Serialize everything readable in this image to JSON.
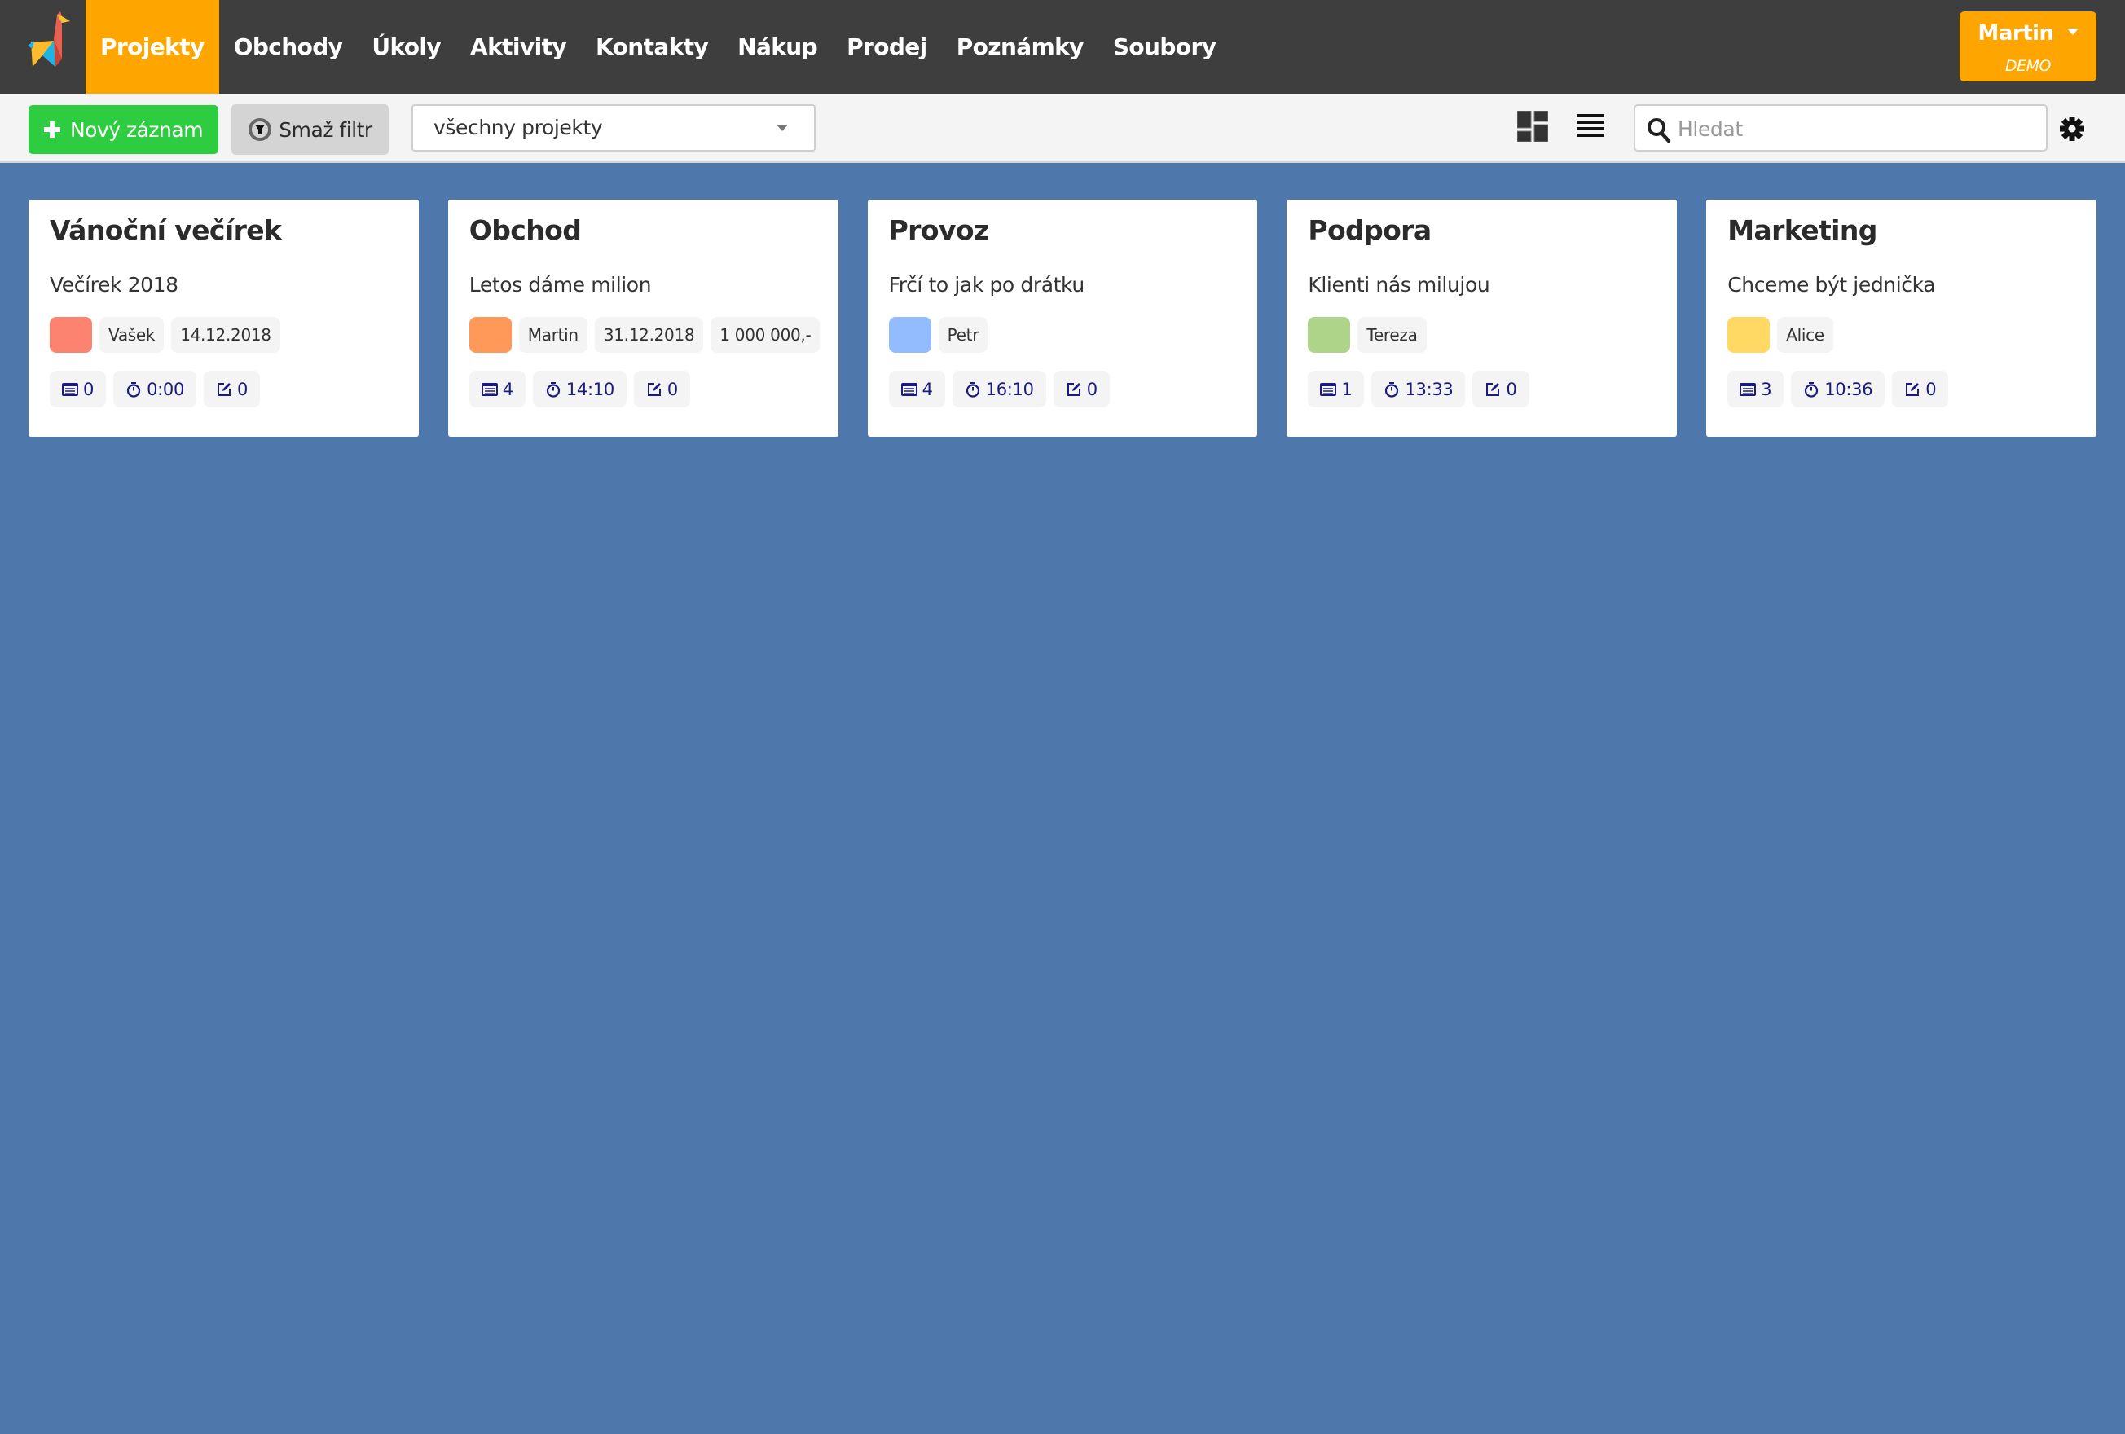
{
  "header": {
    "logo": "giraffe-logo",
    "nav": [
      {
        "label": "Projekty",
        "active": true
      },
      {
        "label": "Obchody",
        "active": false
      },
      {
        "label": "Úkoly",
        "active": false
      },
      {
        "label": "Aktivity",
        "active": false
      },
      {
        "label": "Kontakty",
        "active": false
      },
      {
        "label": "Nákup",
        "active": false
      },
      {
        "label": "Prodej",
        "active": false
      },
      {
        "label": "Poznámky",
        "active": false
      },
      {
        "label": "Soubory",
        "active": false
      }
    ],
    "user": {
      "name": "Martin",
      "role": "DEMO"
    }
  },
  "toolbar": {
    "new_label": "Nový záznam",
    "clear_filter_label": "Smaž filtr",
    "project_filter": {
      "selected": "všechny projekty"
    },
    "search": {
      "placeholder": "Hledat",
      "value": ""
    }
  },
  "colors": {
    "accent": "#ffa500",
    "header_bg": "#3e3e3e",
    "page_bg": "#4e77ab",
    "new_button": "#2ecc40",
    "stat_text": "#1a1a80"
  },
  "projects": [
    {
      "title": "Vánoční večírek",
      "subtitle": "Večírek 2018",
      "color": "#fc8370",
      "owner": "Vašek",
      "tags": [
        "14.12.2018"
      ],
      "stats": {
        "records": "0",
        "time": "0:00",
        "notes": "0"
      }
    },
    {
      "title": "Obchod",
      "subtitle": "Letos dáme milion",
      "color": "#fe995a",
      "owner": "Martin",
      "tags": [
        "31.12.2018",
        "1 000 000,-"
      ],
      "stats": {
        "records": "4",
        "time": "14:10",
        "notes": "0"
      }
    },
    {
      "title": "Provoz",
      "subtitle": "Frčí to jak po drátku",
      "color": "#93bcff",
      "owner": "Petr",
      "tags": [],
      "stats": {
        "records": "4",
        "time": "16:10",
        "notes": "0"
      }
    },
    {
      "title": "Podpora",
      "subtitle": "Klienti nás milujou",
      "color": "#aed48a",
      "owner": "Tereza",
      "tags": [],
      "stats": {
        "records": "1",
        "time": "13:33",
        "notes": "0"
      }
    },
    {
      "title": "Marketing",
      "subtitle": "Chceme být jednička",
      "color": "#ffd964",
      "owner": "Alice",
      "tags": [],
      "stats": {
        "records": "3",
        "time": "10:36",
        "notes": "0"
      }
    }
  ]
}
